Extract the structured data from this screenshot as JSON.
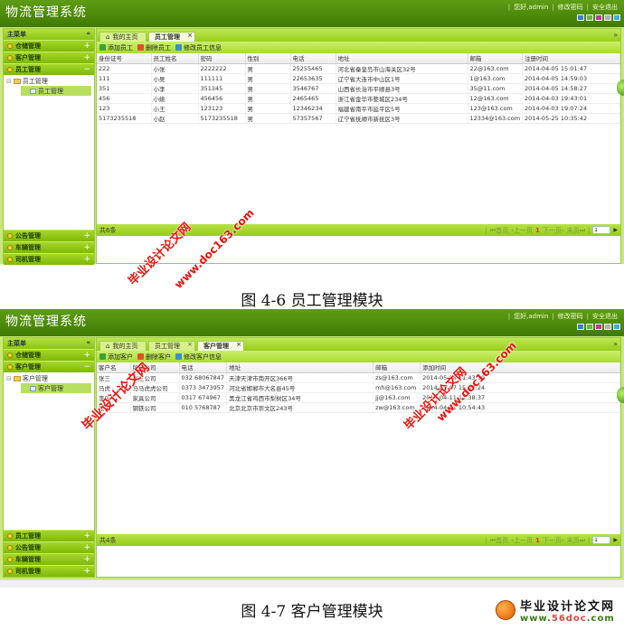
{
  "app_title": "物流管理系统",
  "header": {
    "greeting": "您好,admin",
    "change_password": "修改密码",
    "logout": "安全退出",
    "theme_colors": [
      "#3a7fc4",
      "#6bb44a",
      "#c03a9c",
      "#b0b0b0",
      "#3ab0d8"
    ]
  },
  "screens": [
    {
      "sidebar": {
        "title": "主菜单",
        "collapse_icon": "«",
        "top_items": [
          {
            "label": "仓储管理",
            "toggle": "+"
          },
          {
            "label": "客户管理",
            "toggle": "+"
          },
          {
            "label": "员工管理",
            "toggle": "−"
          }
        ],
        "tree": {
          "folder": "员工管理",
          "leaf": "员工管理"
        },
        "bottom_items": [
          {
            "label": "公告管理",
            "toggle": "+"
          },
          {
            "label": "车辆管理",
            "toggle": "+"
          },
          {
            "label": "司机管理",
            "toggle": "+"
          }
        ]
      },
      "tabs": [
        {
          "label": "我的主页",
          "closable": false,
          "active": false
        },
        {
          "label": "员工管理",
          "closable": true,
          "active": true
        }
      ],
      "toolbar": [
        {
          "label": "添加员工",
          "icon": "add-icon",
          "color": "#3aa23a"
        },
        {
          "label": "删除员工",
          "icon": "delete-icon",
          "color": "#e0502a"
        },
        {
          "label": "修改员工信息",
          "icon": "edit-icon",
          "color": "#3a8fd0"
        }
      ],
      "table": {
        "columns": [
          "身份证号",
          "员工姓名",
          "密码",
          "性别",
          "电话",
          "地址",
          "邮箱",
          "注册时间"
        ],
        "rows": [
          [
            "222",
            "小张",
            "2222222",
            "男",
            "25255465",
            "河北省秦皇岛市山海关区32号",
            "22@163.com",
            "2014-04-05 15:01:47"
          ],
          [
            "111",
            "小吴",
            "111111",
            "男",
            "22653635",
            "辽宁省大连市中山区1号",
            "1@163.com",
            "2014-04-05 14:59:03"
          ],
          [
            "351",
            "小李",
            "351345",
            "男",
            "3546767",
            "山西省长治市平顺县3号",
            "35@11.com",
            "2014-04-05 14:58:27"
          ],
          [
            "456",
            "小姚",
            "456456",
            "男",
            "2465465",
            "浙江省金华市婺城区234号",
            "12@163.com",
            "2014-04-03 19:43:01"
          ],
          [
            "123",
            "小王",
            "123123",
            "男",
            "12346234",
            "福建省南平市延平区5号",
            "123@163.com",
            "2014-04-03 19:07:24"
          ],
          [
            "5173235518",
            "小赵",
            "5173235518",
            "男",
            "57357567",
            "辽宁省抚顺市新抚区3号",
            "12334@163.com",
            "2014-05-25 10:35:42"
          ]
        ]
      },
      "pager": {
        "total": "共6条",
        "first": "首页",
        "prev": "上一页",
        "current": "1",
        "next": "下一页",
        "last": "末页",
        "page_input": "1"
      },
      "caption": "图 4-6 员工管理模块"
    },
    {
      "sidebar": {
        "title": "主菜单",
        "collapse_icon": "«",
        "top_items": [
          {
            "label": "仓储管理",
            "toggle": "+"
          },
          {
            "label": "客户管理",
            "toggle": "−"
          }
        ],
        "tree": {
          "folder": "客户管理",
          "leaf": "客户管理"
        },
        "bottom_items": [
          {
            "label": "员工管理",
            "toggle": "+"
          },
          {
            "label": "公告管理",
            "toggle": "+"
          },
          {
            "label": "车辆管理",
            "toggle": "+"
          },
          {
            "label": "司机管理",
            "toggle": "+"
          }
        ]
      },
      "tabs": [
        {
          "label": "我的主页",
          "closable": false,
          "active": false
        },
        {
          "label": "员工管理",
          "closable": true,
          "active": false
        },
        {
          "label": "客户管理",
          "closable": true,
          "active": true
        }
      ],
      "toolbar": [
        {
          "label": "添加客户",
          "icon": "add-icon",
          "color": "#3aa23a"
        },
        {
          "label": "删除客户",
          "icon": "delete-icon",
          "color": "#e0502a"
        },
        {
          "label": "修改客户信息",
          "icon": "edit-icon",
          "color": "#3a8fd0"
        }
      ],
      "table": {
        "columns": [
          "客户名",
          "所属公司",
          "电话",
          "地址",
          "邮箱",
          "添加时间"
        ],
        "rows": [
          [
            "张三",
            "张三公司",
            "032 68067847",
            "天津天津市南开区366号",
            "zs@163.com",
            "2014-05-08 11:43:19"
          ],
          [
            "马虎",
            "马马虎虎公司",
            "0373 3473957",
            "河北省邯郸市大名县45号",
            "mh@163.com",
            "2014-05-07 15:43:24"
          ],
          [
            "李乐",
            "家具公司",
            "0317 674967",
            "黑龙江省鸡西市梨树区34号",
            "jj@163.com",
            "2014-04-11 11:38:37"
          ],
          [
            "张伟",
            "钢铁公司",
            "010 5768787",
            "北京北京市崇文区243号",
            "zw@163.com",
            "2014-04-11 10:54:43"
          ]
        ]
      },
      "pager": {
        "total": "共4条",
        "first": "首页",
        "prev": "上一页",
        "current": "1",
        "next": "下一页",
        "last": "末页",
        "page_input": "1"
      },
      "caption": "图 4-7 客户管理模块"
    }
  ],
  "watermarks": [
    "毕业设计论文网",
    "www.doc163.com"
  ],
  "brand": {
    "name": "毕业设计论文网",
    "url_prefix": "www.",
    "url_mid": "56doc",
    "url_suffix": ".com"
  }
}
